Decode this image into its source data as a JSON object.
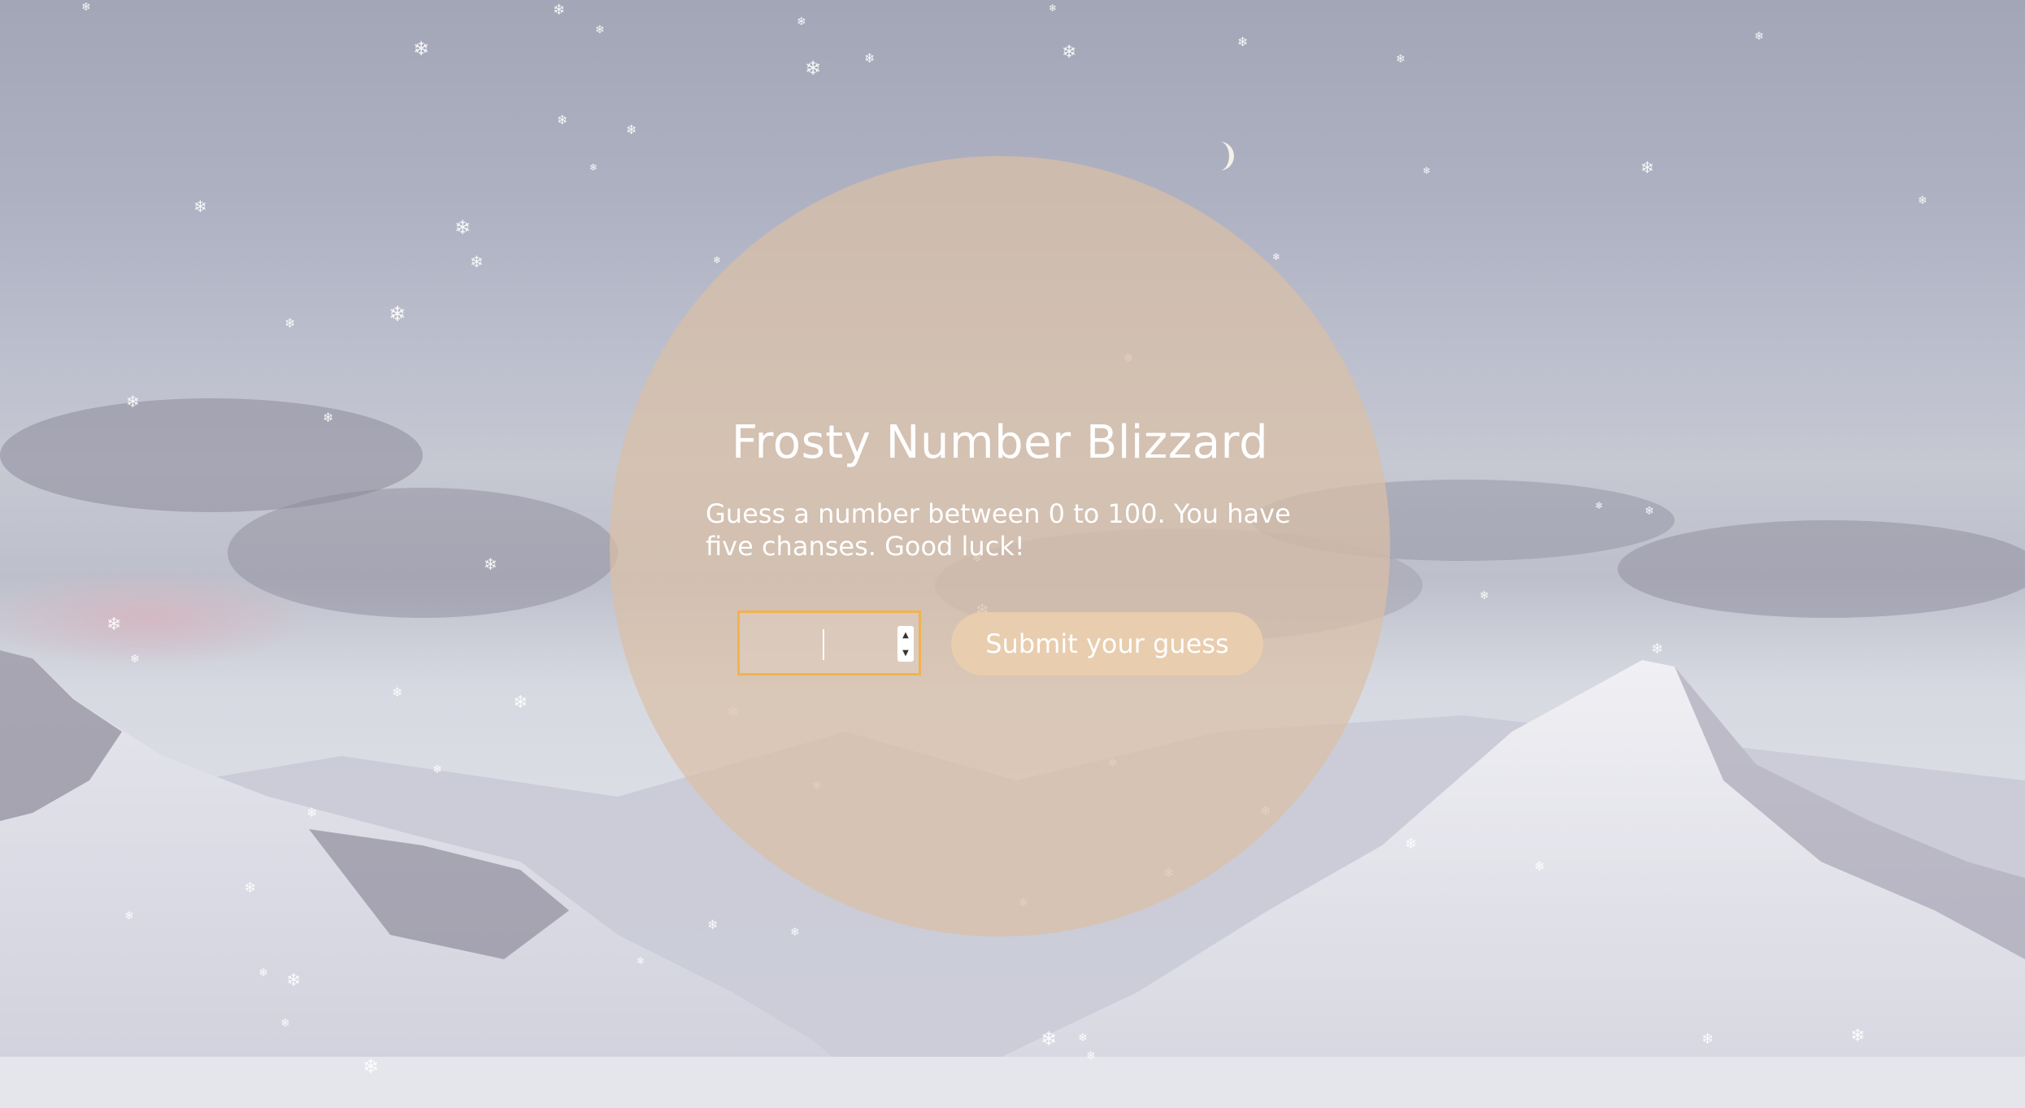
{
  "game": {
    "title": "Frosty Number Blizzard",
    "description": "Guess a number between 0 to 100. You have five chanses. Good luck!",
    "guess_value": "",
    "submit_label": "Submit your guess"
  },
  "icons": {
    "snowflake": "snowflake-icon",
    "moon": "moon-icon",
    "stepper_up": "chevron-up-icon",
    "stepper_down": "chevron-down-icon"
  },
  "colors": {
    "circle": "#dabfa6",
    "button": "#e8cdae",
    "input_border": "#f2b24e",
    "text": "#ffffff"
  }
}
